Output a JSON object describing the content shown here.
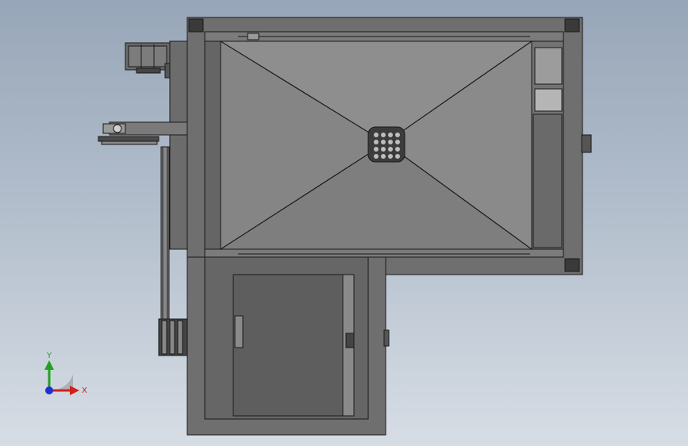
{
  "viewport": {
    "background_top": "#97a6b8",
    "background_bottom": "#d7dde5"
  },
  "model": {
    "frame_color": "#6f6f6f",
    "hopper_color": "#8a8a8a",
    "edge_color": "#1a1a1a"
  },
  "triad": {
    "x_label": "X",
    "y_label": "Y",
    "x_color": "#d02020",
    "y_color": "#22a022",
    "z_color": "#2030d0"
  }
}
